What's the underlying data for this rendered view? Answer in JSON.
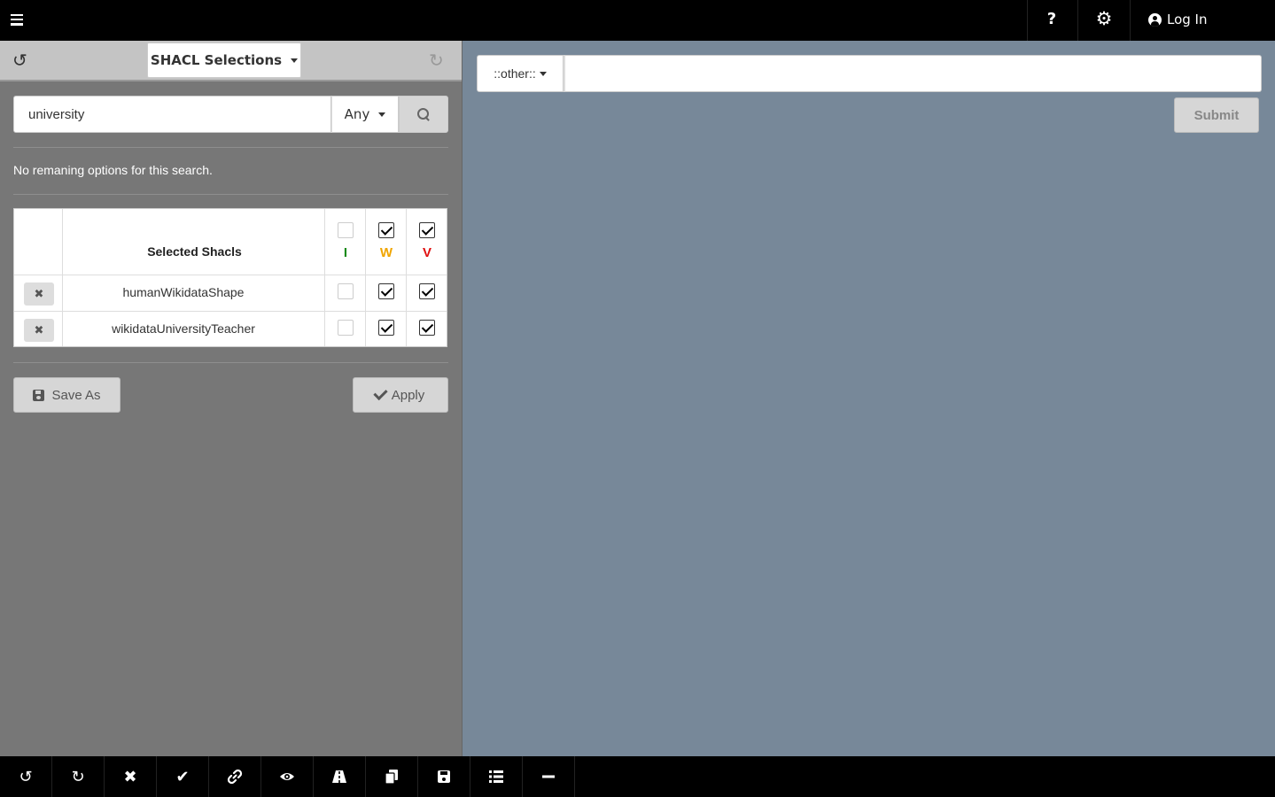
{
  "topbar": {
    "help_label": "?",
    "login_label": "Log In"
  },
  "left": {
    "selector_label": "SHACL Selections",
    "search": {
      "value": "university",
      "scope": "Any"
    },
    "no_options_text": "No remaning options for this search.",
    "table": {
      "header": "Selected Shacls",
      "levels": [
        {
          "label": "I",
          "color": "#1a8a1a",
          "checked": false
        },
        {
          "label": "W",
          "color": "#f0a500",
          "checked": true
        },
        {
          "label": "V",
          "color": "#e01010",
          "checked": true
        }
      ],
      "rows": [
        {
          "name": "humanWikidataShape",
          "I": false,
          "W": true,
          "V": true
        },
        {
          "name": "wikidataUniversityTeacher",
          "I": false,
          "W": true,
          "V": true
        }
      ]
    },
    "save_as_label": "Save As",
    "apply_label": "Apply"
  },
  "right": {
    "type_select": "::other::",
    "query_value": "",
    "submit_label": "Submit"
  },
  "bottombar": {
    "tools": [
      "undo-icon",
      "redo-icon",
      "close-icon",
      "check-icon",
      "link-icon",
      "eye-icon",
      "road-icon",
      "copy-icon",
      "save-icon",
      "list-icon",
      "minus-icon"
    ]
  }
}
